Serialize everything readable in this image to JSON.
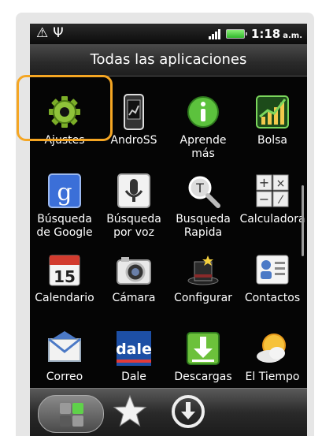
{
  "status_bar": {
    "time": "1:18",
    "ampm": "a.m."
  },
  "title": "Todas las aplicaciones",
  "apps": [
    {
      "id": "ajustes",
      "label": "Ajustes",
      "icon": "gear-icon"
    },
    {
      "id": "andross",
      "label": "AndroSS",
      "icon": "phone-screenshot-icon"
    },
    {
      "id": "aprende",
      "label": "Aprende\nmás",
      "icon": "info-icon"
    },
    {
      "id": "bolsa",
      "label": "Bolsa",
      "icon": "stock-chart-icon"
    },
    {
      "id": "busqueda-google",
      "label": "Búsqueda\nde Google",
      "icon": "google-g-icon"
    },
    {
      "id": "busqueda-voz",
      "label": "Búsqueda\npor voz",
      "icon": "microphone-icon"
    },
    {
      "id": "busqueda-rapida",
      "label": "Busqueda\nRapida",
      "icon": "magnifier-icon"
    },
    {
      "id": "calculadora",
      "label": "Calculadora",
      "icon": "calculator-icon"
    },
    {
      "id": "calendario",
      "label": "Calendario",
      "icon": "calendar-icon",
      "badge": "15"
    },
    {
      "id": "camara",
      "label": "Cámara",
      "icon": "camera-icon"
    },
    {
      "id": "configurar",
      "label": "Configurar",
      "icon": "magic-hat-icon"
    },
    {
      "id": "contactos",
      "label": "Contactos",
      "icon": "contacts-icon"
    },
    {
      "id": "correo",
      "label": "Correo",
      "icon": "envelope-icon"
    },
    {
      "id": "dale",
      "label": "Dale",
      "icon": "dale-logo-icon",
      "logo_text": "dale"
    },
    {
      "id": "descargas",
      "label": "Descargas",
      "icon": "download-icon"
    },
    {
      "id": "el-tiempo",
      "label": "El Tiempo",
      "icon": "weather-sun-icon"
    }
  ],
  "highlighted_app": "ajustes",
  "highlight_color": "#f5a623",
  "dock": [
    {
      "id": "all-apps",
      "icon": "all-apps-grid-icon"
    },
    {
      "id": "favorites",
      "icon": "star-icon"
    },
    {
      "id": "phone",
      "icon": "phone-download-icon"
    }
  ]
}
